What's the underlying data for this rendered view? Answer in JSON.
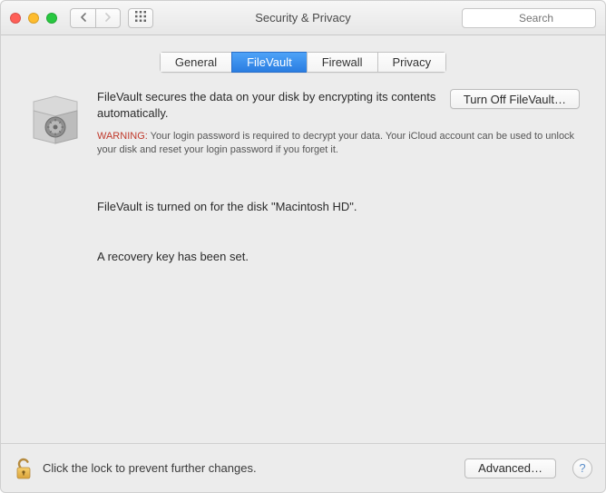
{
  "window": {
    "title": "Security & Privacy"
  },
  "toolbar": {
    "search_placeholder": "Search"
  },
  "tabs": {
    "general": "General",
    "filevault": "FileVault",
    "firewall": "Firewall",
    "privacy": "Privacy",
    "active": "filevault"
  },
  "main": {
    "intro": "FileVault secures the data on your disk by encrypting its contents automatically.",
    "turn_off_label": "Turn Off FileVault…",
    "warning_label": "WARNING:",
    "warning_text": " Your login password is required to decrypt your data. Your iCloud account can be used to unlock your disk and reset your login password if you forget it.",
    "status": "FileVault is turned on for the disk \"Macintosh HD\".",
    "recovery": "A recovery key has been set."
  },
  "footer": {
    "lock_text": "Click the lock to prevent further changes.",
    "advanced_label": "Advanced…",
    "help_label": "?"
  }
}
